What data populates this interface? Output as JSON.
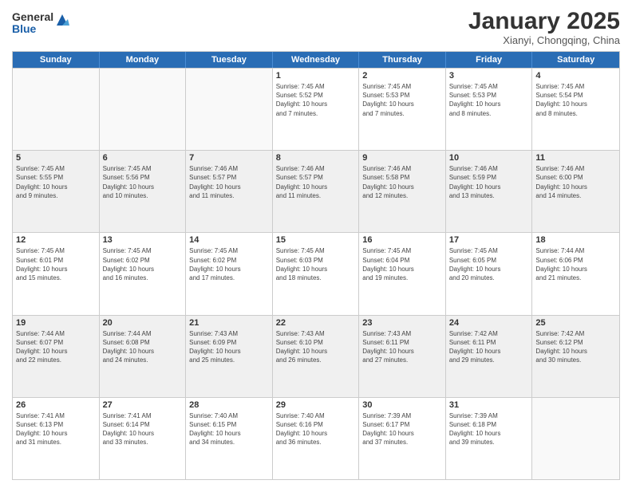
{
  "logo": {
    "general": "General",
    "blue": "Blue"
  },
  "header": {
    "title": "January 2025",
    "subtitle": "Xianyi, Chongqing, China"
  },
  "weekdays": [
    "Sunday",
    "Monday",
    "Tuesday",
    "Wednesday",
    "Thursday",
    "Friday",
    "Saturday"
  ],
  "rows": [
    [
      {
        "day": "",
        "detail": "",
        "empty": true
      },
      {
        "day": "",
        "detail": "",
        "empty": true
      },
      {
        "day": "",
        "detail": "",
        "empty": true
      },
      {
        "day": "1",
        "detail": "Sunrise: 7:45 AM\nSunset: 5:52 PM\nDaylight: 10 hours\nand 7 minutes."
      },
      {
        "day": "2",
        "detail": "Sunrise: 7:45 AM\nSunset: 5:53 PM\nDaylight: 10 hours\nand 7 minutes."
      },
      {
        "day": "3",
        "detail": "Sunrise: 7:45 AM\nSunset: 5:53 PM\nDaylight: 10 hours\nand 8 minutes."
      },
      {
        "day": "4",
        "detail": "Sunrise: 7:45 AM\nSunset: 5:54 PM\nDaylight: 10 hours\nand 8 minutes."
      }
    ],
    [
      {
        "day": "5",
        "detail": "Sunrise: 7:45 AM\nSunset: 5:55 PM\nDaylight: 10 hours\nand 9 minutes.",
        "shaded": true
      },
      {
        "day": "6",
        "detail": "Sunrise: 7:45 AM\nSunset: 5:56 PM\nDaylight: 10 hours\nand 10 minutes.",
        "shaded": true
      },
      {
        "day": "7",
        "detail": "Sunrise: 7:46 AM\nSunset: 5:57 PM\nDaylight: 10 hours\nand 11 minutes.",
        "shaded": true
      },
      {
        "day": "8",
        "detail": "Sunrise: 7:46 AM\nSunset: 5:57 PM\nDaylight: 10 hours\nand 11 minutes.",
        "shaded": true
      },
      {
        "day": "9",
        "detail": "Sunrise: 7:46 AM\nSunset: 5:58 PM\nDaylight: 10 hours\nand 12 minutes.",
        "shaded": true
      },
      {
        "day": "10",
        "detail": "Sunrise: 7:46 AM\nSunset: 5:59 PM\nDaylight: 10 hours\nand 13 minutes.",
        "shaded": true
      },
      {
        "day": "11",
        "detail": "Sunrise: 7:46 AM\nSunset: 6:00 PM\nDaylight: 10 hours\nand 14 minutes.",
        "shaded": true
      }
    ],
    [
      {
        "day": "12",
        "detail": "Sunrise: 7:45 AM\nSunset: 6:01 PM\nDaylight: 10 hours\nand 15 minutes."
      },
      {
        "day": "13",
        "detail": "Sunrise: 7:45 AM\nSunset: 6:02 PM\nDaylight: 10 hours\nand 16 minutes."
      },
      {
        "day": "14",
        "detail": "Sunrise: 7:45 AM\nSunset: 6:02 PM\nDaylight: 10 hours\nand 17 minutes."
      },
      {
        "day": "15",
        "detail": "Sunrise: 7:45 AM\nSunset: 6:03 PM\nDaylight: 10 hours\nand 18 minutes."
      },
      {
        "day": "16",
        "detail": "Sunrise: 7:45 AM\nSunset: 6:04 PM\nDaylight: 10 hours\nand 19 minutes."
      },
      {
        "day": "17",
        "detail": "Sunrise: 7:45 AM\nSunset: 6:05 PM\nDaylight: 10 hours\nand 20 minutes."
      },
      {
        "day": "18",
        "detail": "Sunrise: 7:44 AM\nSunset: 6:06 PM\nDaylight: 10 hours\nand 21 minutes."
      }
    ],
    [
      {
        "day": "19",
        "detail": "Sunrise: 7:44 AM\nSunset: 6:07 PM\nDaylight: 10 hours\nand 22 minutes.",
        "shaded": true
      },
      {
        "day": "20",
        "detail": "Sunrise: 7:44 AM\nSunset: 6:08 PM\nDaylight: 10 hours\nand 24 minutes.",
        "shaded": true
      },
      {
        "day": "21",
        "detail": "Sunrise: 7:43 AM\nSunset: 6:09 PM\nDaylight: 10 hours\nand 25 minutes.",
        "shaded": true
      },
      {
        "day": "22",
        "detail": "Sunrise: 7:43 AM\nSunset: 6:10 PM\nDaylight: 10 hours\nand 26 minutes.",
        "shaded": true
      },
      {
        "day": "23",
        "detail": "Sunrise: 7:43 AM\nSunset: 6:11 PM\nDaylight: 10 hours\nand 27 minutes.",
        "shaded": true
      },
      {
        "day": "24",
        "detail": "Sunrise: 7:42 AM\nSunset: 6:11 PM\nDaylight: 10 hours\nand 29 minutes.",
        "shaded": true
      },
      {
        "day": "25",
        "detail": "Sunrise: 7:42 AM\nSunset: 6:12 PM\nDaylight: 10 hours\nand 30 minutes.",
        "shaded": true
      }
    ],
    [
      {
        "day": "26",
        "detail": "Sunrise: 7:41 AM\nSunset: 6:13 PM\nDaylight: 10 hours\nand 31 minutes."
      },
      {
        "day": "27",
        "detail": "Sunrise: 7:41 AM\nSunset: 6:14 PM\nDaylight: 10 hours\nand 33 minutes."
      },
      {
        "day": "28",
        "detail": "Sunrise: 7:40 AM\nSunset: 6:15 PM\nDaylight: 10 hours\nand 34 minutes."
      },
      {
        "day": "29",
        "detail": "Sunrise: 7:40 AM\nSunset: 6:16 PM\nDaylight: 10 hours\nand 36 minutes."
      },
      {
        "day": "30",
        "detail": "Sunrise: 7:39 AM\nSunset: 6:17 PM\nDaylight: 10 hours\nand 37 minutes."
      },
      {
        "day": "31",
        "detail": "Sunrise: 7:39 AM\nSunset: 6:18 PM\nDaylight: 10 hours\nand 39 minutes."
      },
      {
        "day": "",
        "detail": "",
        "empty": true
      }
    ]
  ]
}
